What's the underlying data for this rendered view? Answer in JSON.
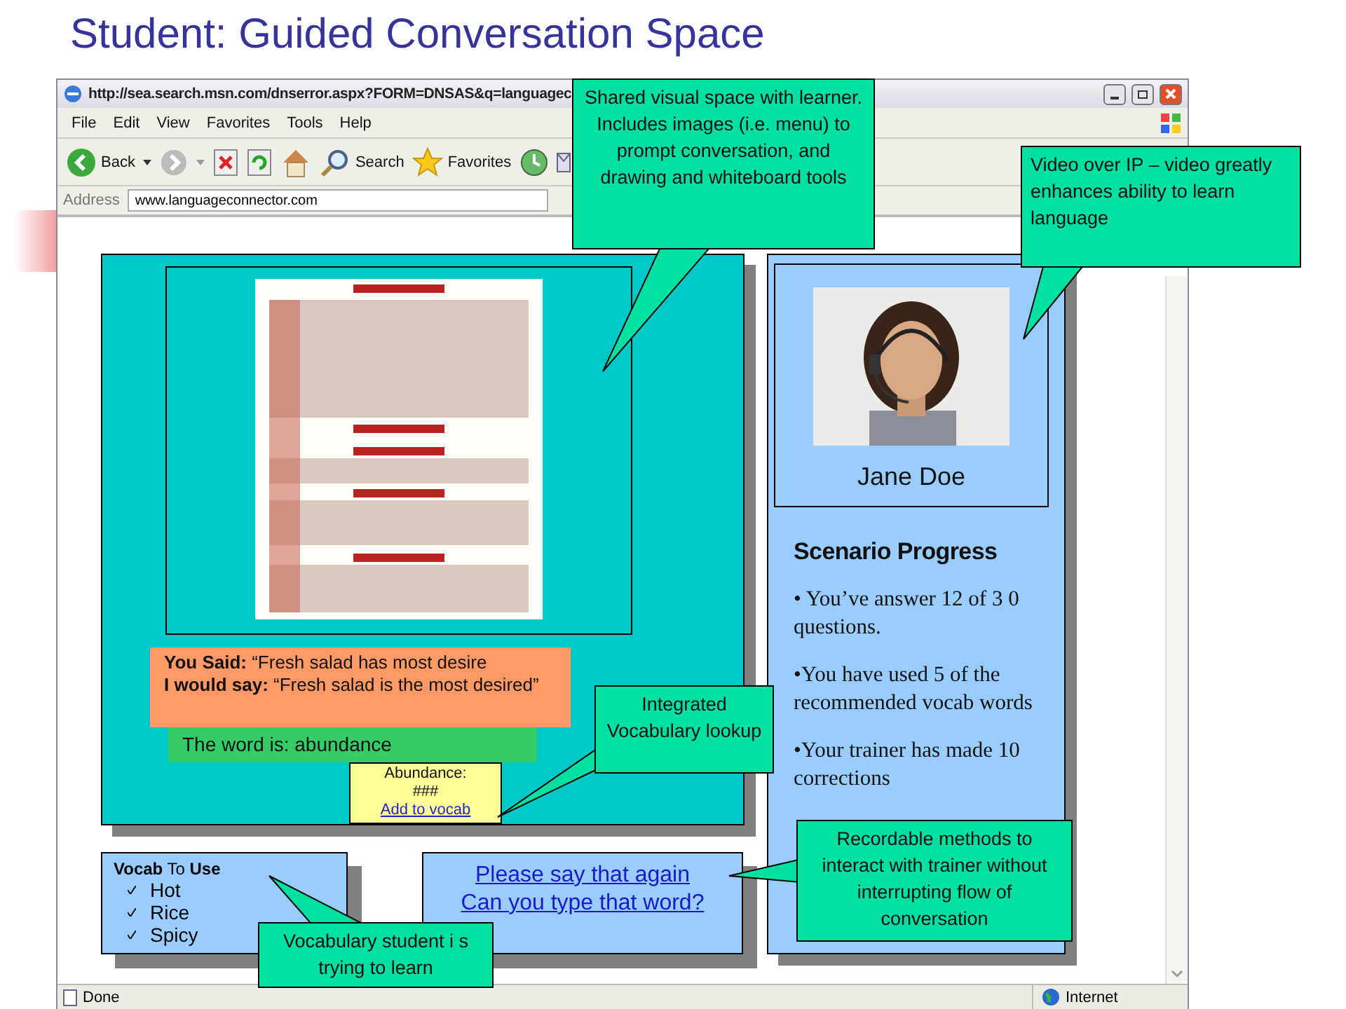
{
  "slide_title": "Student: Guided Conversation Space",
  "browser": {
    "title": "http://sea.search.msn.com/dnserror.aspx?FORM=DNSAS&q=languagec",
    "menu": [
      "File",
      "Edit",
      "View",
      "Favorites",
      "Tools",
      "Help"
    ],
    "back": "Back",
    "search": "Search",
    "favorites": "Favorites",
    "address_label": "Address",
    "address": "www.languageconnector.com",
    "status": "Done",
    "zone": "Internet"
  },
  "feedback": [
    "**You Said:** “Fresh salad has most desire",
    "**I would say:** “Fresh salad is the most desired”"
  ],
  "word_hint": "The word is: abundance",
  "lookup": {
    "word": "Abundance:",
    "definition": "###",
    "link": "Add to vocab"
  },
  "video": {
    "name": "Jane Doe"
  },
  "progress": {
    "title": "Scenario Progress",
    "items": [
      "• You’ve answer 12 of  3 0 questions.",
      "•You have used 5 of  the recommended vocab words",
      "•Your trainer has made 10 corrections"
    ]
  },
  "vocab": {
    "title": "**Vocab** To **Use**",
    "items": [
      "Hot",
      "Rice",
      "Spicy"
    ]
  },
  "phrases": [
    "Please say that again",
    "Can you type that word?"
  ],
  "callouts": [
    "Shared visual space with learner. Includes images (i.e. menu) to prompt conversation, and drawing and whiteboard tools",
    "Video over IP – video greatly enhances ability  to learn language",
    "Integrated Vocabulary lookup",
    "Recordable methods to interact with trainer without interrupting flow of conversation",
    "Vocabulary student i s trying to learn"
  ]
}
